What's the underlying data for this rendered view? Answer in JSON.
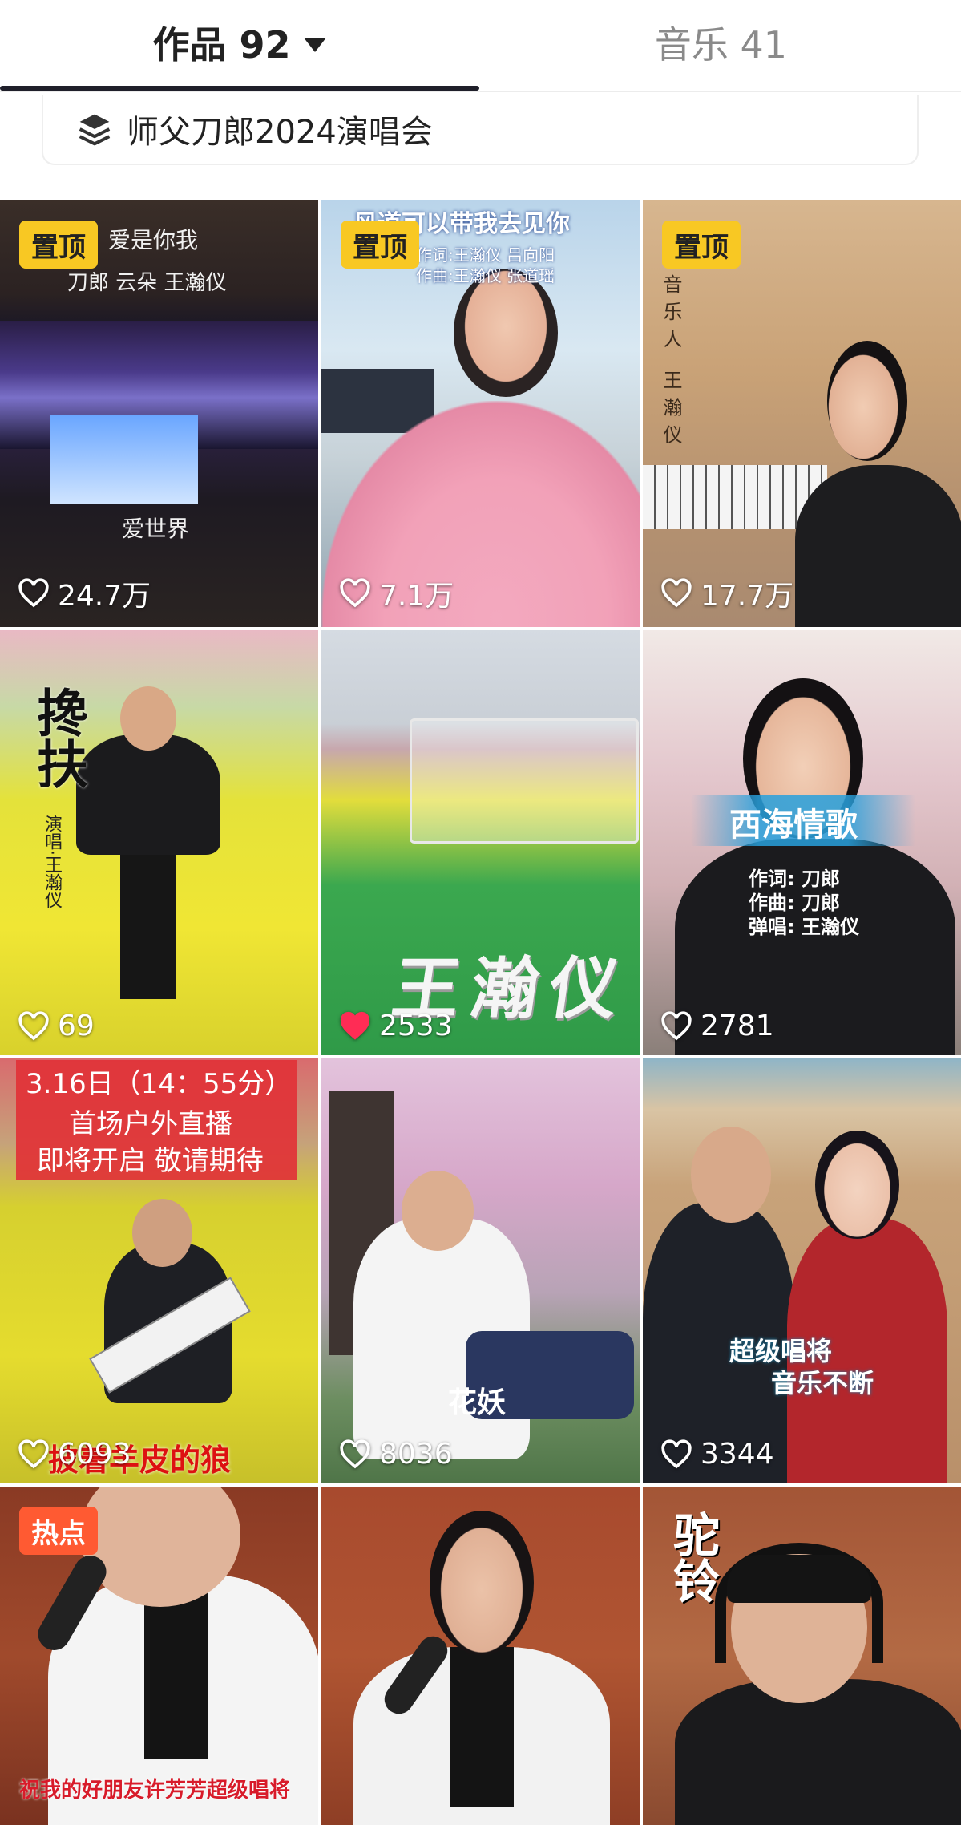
{
  "tabs": {
    "works": "作品 92",
    "music": "音乐 41"
  },
  "collection": {
    "label": "师父刀郎2024演唱会",
    "icon": "layers-icon"
  },
  "colors": {
    "pin_badge": "#f8c823",
    "hot_badge": "#ff5a32",
    "liked_heart": "#ff2c55",
    "indicator": "#1f1f2a"
  },
  "videos": [
    {
      "badge": "置顶",
      "likes": "24.7万",
      "liked": false,
      "texts": {
        "t1": "爱是你我",
        "t2": "刀郎 云朵 王瀚仪",
        "t3": "爱世界"
      }
    },
    {
      "badge": "置顶",
      "likes": "7.1万",
      "liked": false,
      "texts": {
        "t1": "风道可以带我去见你",
        "t2": "作词:王瀚仪 吕向阳",
        "t3": "作曲:王瀚仪 张道瑶"
      }
    },
    {
      "badge": "置顶",
      "likes": "17.7万",
      "liked": false,
      "texts": {
        "t1": "音乐人 王瀚仪"
      }
    },
    {
      "likes": "69",
      "liked": false,
      "texts": {
        "t1": "搀扶",
        "t2": "演唱·王瀚仪"
      }
    },
    {
      "likes": "2533",
      "liked": true,
      "texts": {
        "t1": "王瀚仪"
      }
    },
    {
      "likes": "2781",
      "liked": false,
      "texts": {
        "t1": "西海情歌",
        "t2": "作词:  刀郎",
        "t3": "作曲:  刀郎",
        "t4": "弹唱:  王瀚仪"
      }
    },
    {
      "likes": "6093",
      "liked": false,
      "texts": {
        "t1": "3.16日（14：55分）",
        "t2": "首场户外直播",
        "t3": "即将开启 敬请期待",
        "t4": "披着羊皮的狼"
      }
    },
    {
      "likes": "8036",
      "liked": false,
      "texts": {
        "t1": "花妖"
      }
    },
    {
      "likes": "3344",
      "liked": false,
      "texts": {
        "t1": "超级唱将",
        "t2": "音乐不断"
      }
    },
    {
      "badge": "热点",
      "texts": {
        "t1": "祝我的好朋友许芳芳超级唱将"
      }
    },
    {
      "texts": {}
    },
    {
      "texts": {
        "t1": "驼铃"
      }
    }
  ]
}
